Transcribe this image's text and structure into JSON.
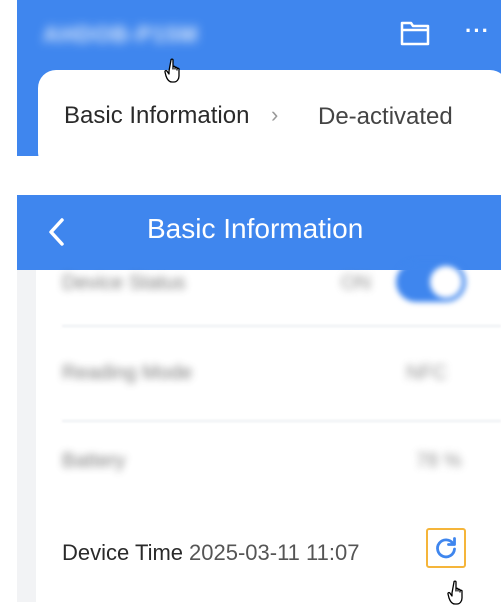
{
  "panel1": {
    "title": "AHDOB-P15M",
    "basic_info_label": "Basic Information",
    "chevron": "›",
    "status_value": "De-activated",
    "more_label": "···"
  },
  "panel2": {
    "nav_title": "Basic Information",
    "rows": [
      {
        "label": "Device Status",
        "value": "ON"
      },
      {
        "label": "Reading Mode",
        "value": "NFC"
      },
      {
        "label": "Battery",
        "value": "78 %"
      }
    ],
    "device_time_label": "Device Time",
    "device_time_value": "2025-03-11 11:07"
  },
  "colors": {
    "brand_blue": "#3f86ee",
    "highlight_orange": "#f5b53a",
    "background": "#f2f3f5"
  },
  "icons": [
    "folder-icon",
    "more-icon",
    "back-icon",
    "refresh-icon",
    "hand-cursor-icon"
  ]
}
